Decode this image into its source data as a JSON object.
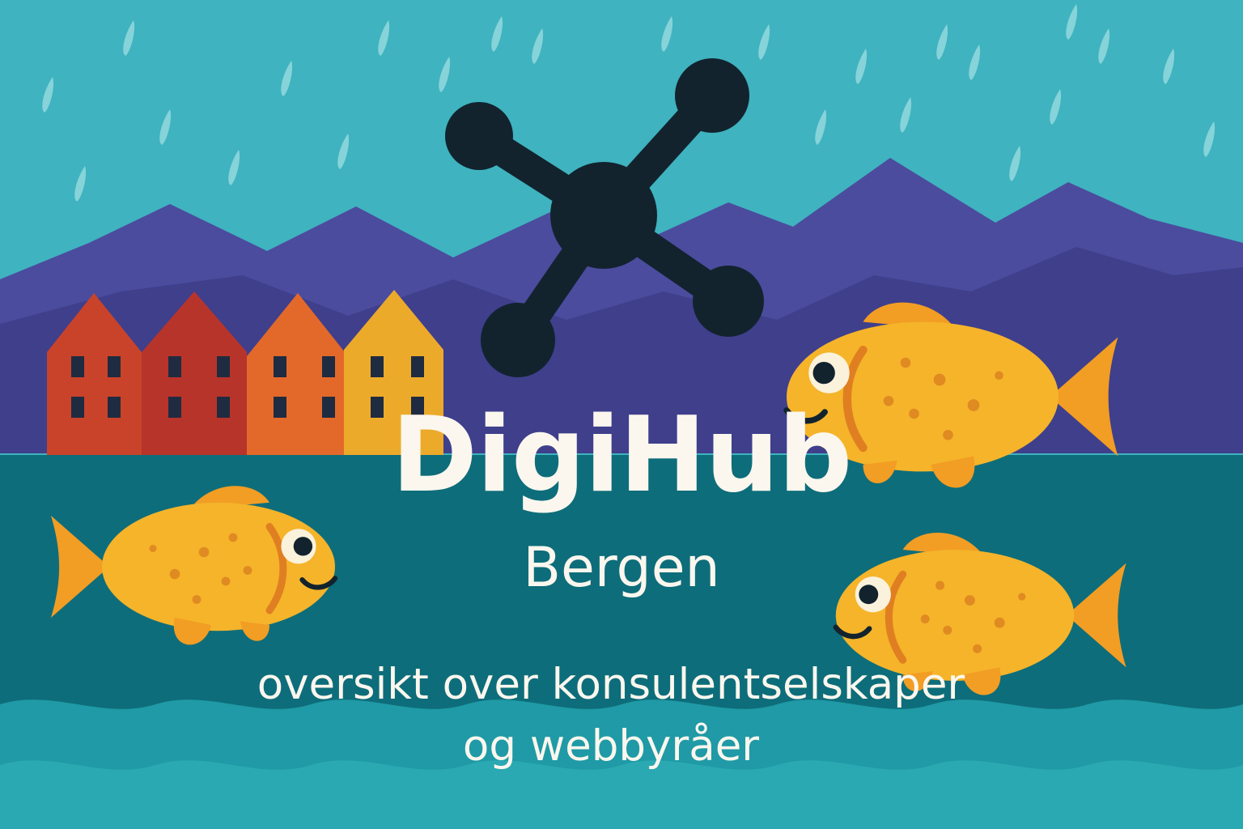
{
  "title": "DigiHub",
  "subtitle": "Bergen",
  "tagline": {
    "line1": "oversikt over konsulentselskaper",
    "line2": "og webbyråer"
  },
  "icons": {
    "logo": "node-cross-logo-icon",
    "fish": "goldfish-icon",
    "house": "wharf-house-icon"
  },
  "colors": {
    "sky": "#3fb3bf",
    "mountain": "#4a4a9a",
    "sea": "#0e6d7a",
    "wave": "#1f9aa6",
    "logo": "#12232e",
    "fish": "#f5b42a",
    "text": "#fbf7ee"
  }
}
